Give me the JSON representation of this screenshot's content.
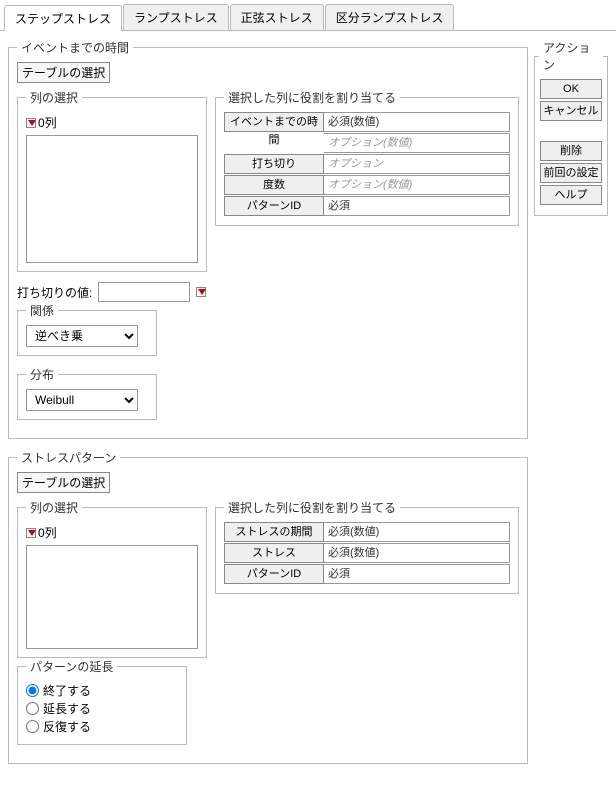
{
  "tabs": [
    "ステップストレス",
    "ランプストレス",
    "正弦ストレス",
    "区分ランプストレス"
  ],
  "active_tab": 0,
  "time_to_event": {
    "legend": "イベントまでの時間",
    "table_select": "テーブルの選択",
    "col_select": {
      "legend": "列の選択",
      "zero_cols": "0列"
    },
    "role": {
      "legend": "選択した列に役割を割り当てる",
      "rows": [
        {
          "btn": "イベントまでの時間",
          "field": "必須(数値)",
          "ph": false
        },
        {
          "btn": "",
          "field": "オプション(数値)",
          "ph": true,
          "option_row": true
        },
        {
          "btn": "打ち切り",
          "field": "オプション",
          "ph": true
        },
        {
          "btn": "度数",
          "field": "オプション(数値)",
          "ph": true
        },
        {
          "btn": "パターンID",
          "field": "必須",
          "ph": false
        }
      ]
    },
    "censor_label": "打ち切りの値:",
    "relation": {
      "legend": "関係",
      "value": "逆べき乗"
    },
    "distribution": {
      "legend": "分布",
      "value": "Weibull"
    }
  },
  "stress_pattern": {
    "legend": "ストレスパターン",
    "table_select": "テーブルの選択",
    "col_select": {
      "legend": "列の選択",
      "zero_cols": "0列"
    },
    "role": {
      "legend": "選択した列に役割を割り当てる",
      "rows": [
        {
          "btn": "ストレスの期間",
          "field": "必須(数値)"
        },
        {
          "btn": "ストレス",
          "field": "必須(数値)"
        },
        {
          "btn": "パターンID",
          "field": "必須"
        }
      ]
    },
    "pattern_ext": {
      "legend": "パターンの延長",
      "options": [
        "終了する",
        "延長する",
        "反復する"
      ],
      "selected": 0
    }
  },
  "actions": {
    "legend": "アクション",
    "buttons": [
      "OK",
      "キャンセル",
      "削除",
      "前回の設定",
      "ヘルプ"
    ]
  }
}
